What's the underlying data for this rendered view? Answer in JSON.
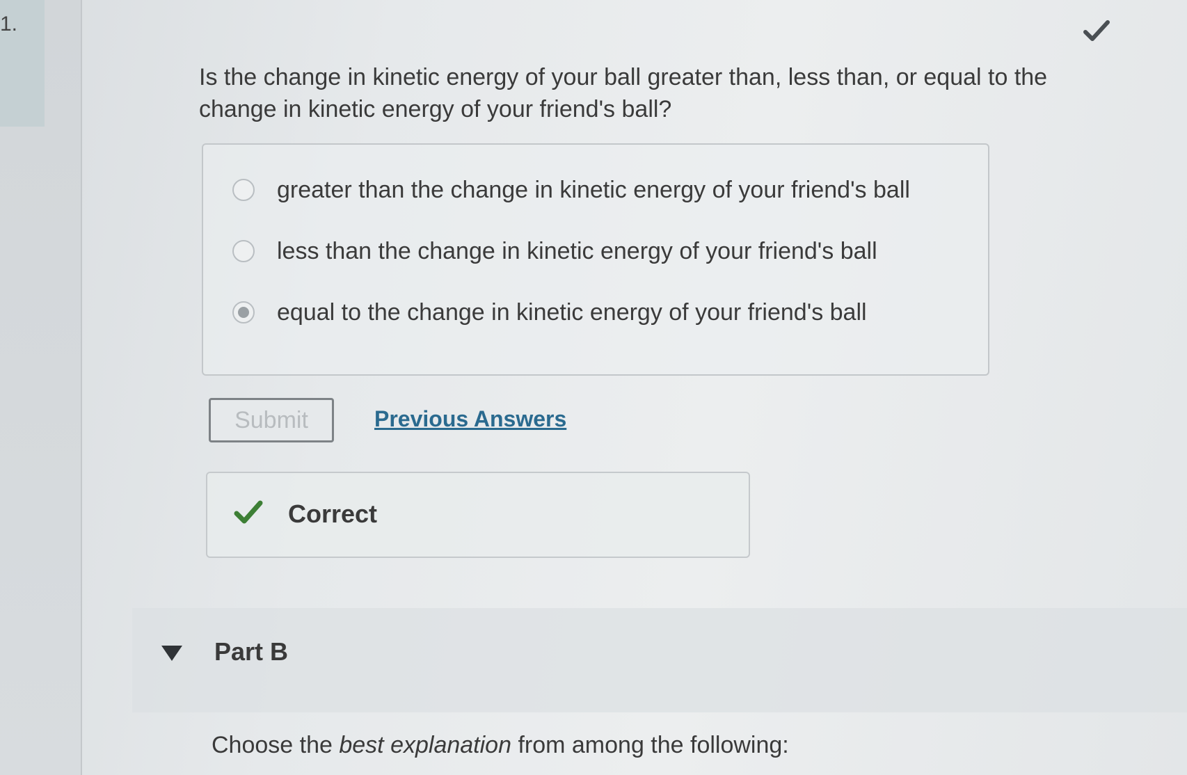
{
  "part_number": "1.",
  "question": {
    "text": "Is the change in kinetic energy of your ball greater than, less than, or equal to the change in kinetic energy of your friend's ball?"
  },
  "options": [
    {
      "label": "greater than the change in kinetic energy of your friend's ball",
      "selected": false
    },
    {
      "label": "less than the change in kinetic energy of your friend's ball",
      "selected": false
    },
    {
      "label": "equal to the change in kinetic energy of your friend's ball",
      "selected": true
    }
  ],
  "actions": {
    "submit_label": "Submit",
    "previous_answers_label": "Previous Answers"
  },
  "feedback": {
    "status": "Correct",
    "color": "#3d7f35"
  },
  "part_b": {
    "label": "Part B",
    "instruction_pre": "Choose the ",
    "instruction_em": "best explanation",
    "instruction_post": " from among the following:"
  },
  "colors": {
    "link": "#2a6a8f",
    "check": "#3d7f35",
    "corner_check": "#4a4f53"
  }
}
